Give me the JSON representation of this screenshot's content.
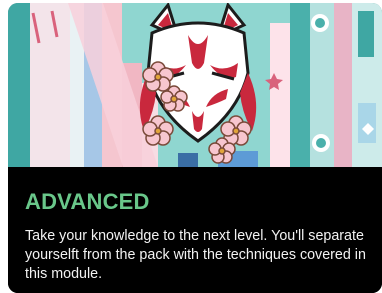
{
  "module": {
    "level": "ADVANCED",
    "description": "Take your knowledge to the next level. You'll separate yourselft from the pack with the techniques covered in this module.",
    "illustration_icon": "kitsune-mask-illustration",
    "colors": {
      "level_text": "#69c78a",
      "panel_background": "#000000",
      "description_text": "#f2f2f2"
    }
  }
}
